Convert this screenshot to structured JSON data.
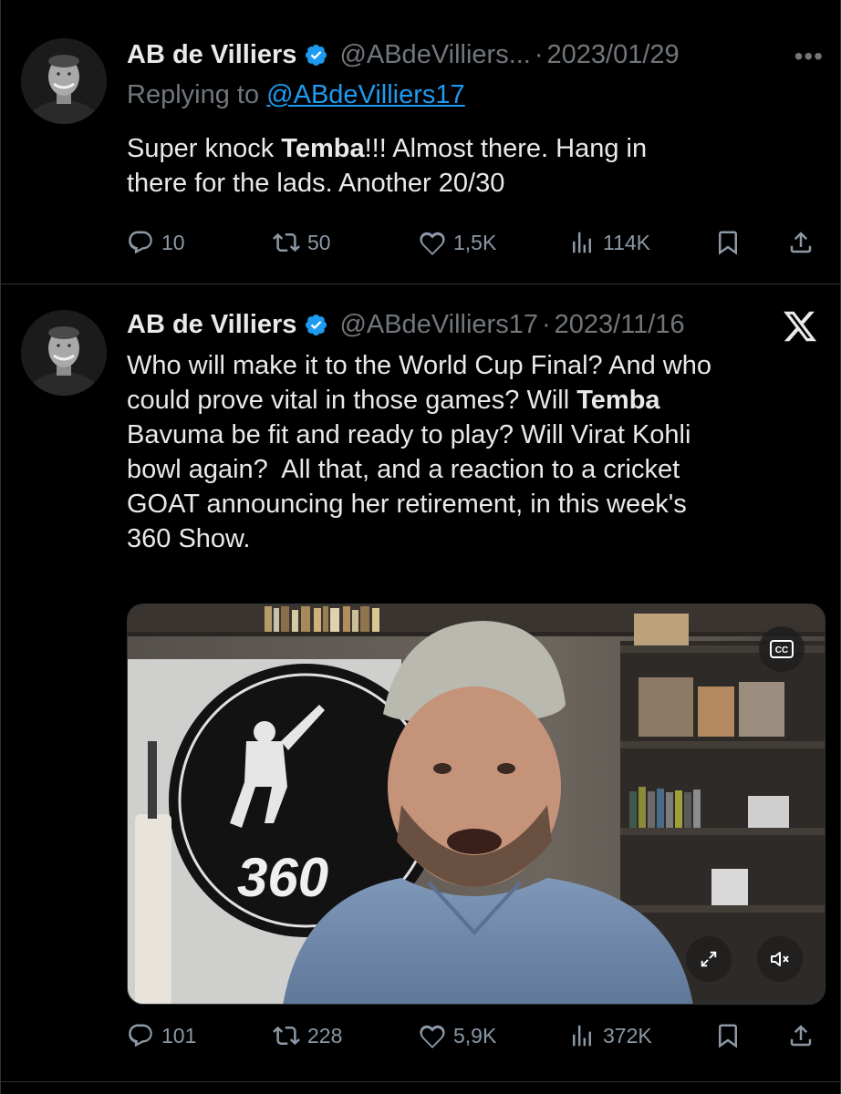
{
  "tweets": [
    {
      "author_name": "AB de Villiers",
      "handle": "@ABdeVilliers...",
      "separator": "·",
      "date": "2023/01/29",
      "more_label": "•••",
      "reply_prefix": "Replying to",
      "reply_handle": "@ABdeVilliers17",
      "text_before": "Super knock ",
      "text_bold": "Temba",
      "text_after": "!!! Almost there. Hang in\nthere for the lads. Another 20/30",
      "replies": "10",
      "retweets": "50",
      "likes": "1,5K",
      "views": "114K"
    },
    {
      "author_name": "AB de Villiers",
      "handle": "@ABdeVilliers17",
      "separator": "·",
      "date": "2023/11/16",
      "text_before": "Who will make it to the World Cup Final? And who\ncould prove vital in those games? Will ",
      "text_bold": "Temba",
      "text_after": "\nBavuma be fit and ready to play? Will Virat Kohli\nbowl again?  All that, and a reaction to a cricket\nGOAT announcing her retirement, in this week's\n360 Show.",
      "video_logo_text": "360",
      "video_cc_label": "CC",
      "replies": "101",
      "retweets": "228",
      "likes": "5,9K",
      "views": "372K"
    }
  ],
  "icons": {
    "verified": "verified-badge-icon",
    "reply": "reply-icon",
    "retweet": "retweet-icon",
    "like": "heart-icon",
    "views": "views-icon",
    "bookmark": "bookmark-icon",
    "share": "share-icon",
    "platform": "x-logo-icon",
    "expand": "expand-icon",
    "mute": "mute-icon"
  },
  "colors": {
    "background": "#000000",
    "text": "#e7e9ea",
    "secondary": "#71767b",
    "link": "#1d9bf0",
    "verified": "#1d9bf0",
    "divider": "#2f3336"
  }
}
